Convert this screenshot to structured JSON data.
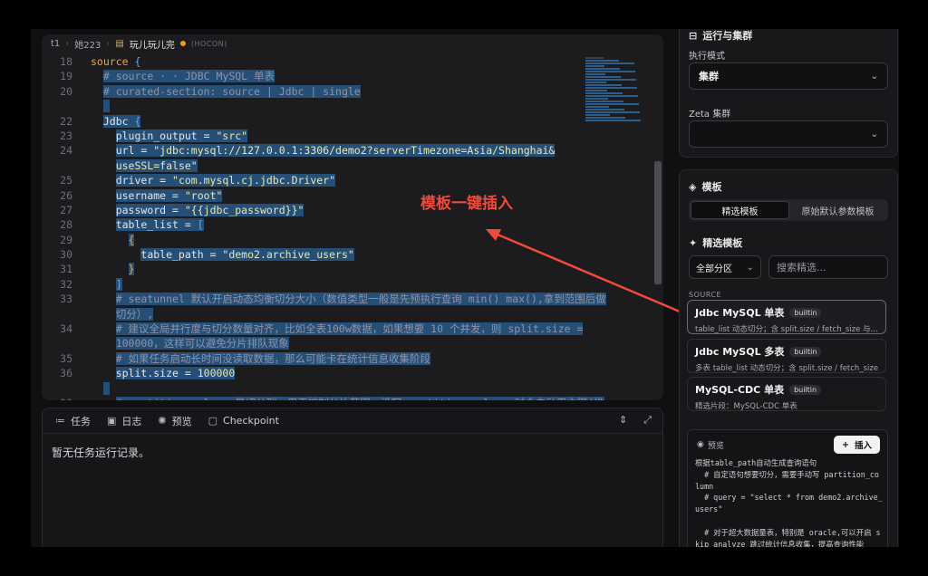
{
  "breadcrumb": {
    "items": [
      "t1",
      "她223",
      "玩儿玩儿完"
    ],
    "lang": "(HOCON)"
  },
  "editor": {
    "lines": [
      {
        "n": "18",
        "indent": "",
        "parts": [
          {
            "t": "source ",
            "c": "kw"
          },
          {
            "t": "{",
            "c": "br"
          }
        ],
        "sel": false
      },
      {
        "n": "19",
        "indent": "  ",
        "parts": [
          {
            "t": "# source · · JDBC MySQL 单表",
            "c": "cmt"
          }
        ],
        "sel": true
      },
      {
        "n": "20",
        "indent": "  ",
        "parts": [
          {
            "t": "# curated-section: source | Jdbc | single",
            "c": "cmt"
          }
        ],
        "sel": true
      },
      {
        "n": "",
        "indent": "  ",
        "parts": [
          {
            "t": " ",
            "c": ""
          }
        ],
        "sel": true
      },
      {
        "n": "22",
        "indent": "  ",
        "parts": [
          {
            "t": "Jdbc ",
            "c": ""
          },
          {
            "t": "{",
            "c": "br"
          }
        ],
        "sel": true
      },
      {
        "n": "23",
        "indent": "    ",
        "parts": [
          {
            "t": "plugin_output = ",
            "c": ""
          },
          {
            "t": "\"src\"",
            "c": "str"
          }
        ],
        "sel": true
      },
      {
        "n": "24",
        "indent": "    ",
        "parts": [
          {
            "t": "url = ",
            "c": ""
          },
          {
            "t": "\"jdbc:mysql://127.0.0.1:3306/demo2?serverTimezone=Asia/Shanghai&",
            "c": "str"
          }
        ],
        "sel": true
      },
      {
        "n": "",
        "indent": "    ",
        "parts": [
          {
            "t": "useSSL=false\"",
            "c": "str"
          }
        ],
        "sel": true
      },
      {
        "n": "25",
        "indent": "    ",
        "parts": [
          {
            "t": "driver = ",
            "c": ""
          },
          {
            "t": "\"com.mysql.cj.jdbc.Driver\"",
            "c": "str"
          }
        ],
        "sel": true
      },
      {
        "n": "26",
        "indent": "    ",
        "parts": [
          {
            "t": "username = ",
            "c": ""
          },
          {
            "t": "\"root\"",
            "c": "str"
          }
        ],
        "sel": true
      },
      {
        "n": "27",
        "indent": "    ",
        "parts": [
          {
            "t": "password = ",
            "c": ""
          },
          {
            "t": "\"{{jdbc_password}}\"",
            "c": "str"
          }
        ],
        "sel": true
      },
      {
        "n": "28",
        "indent": "    ",
        "parts": [
          {
            "t": "table_list = ",
            "c": ""
          },
          {
            "t": "[",
            "c": "br"
          }
        ],
        "sel": true
      },
      {
        "n": "29",
        "indent": "      ",
        "parts": [
          {
            "t": "{",
            "c": "kw"
          }
        ],
        "sel": true
      },
      {
        "n": "30",
        "indent": "        ",
        "parts": [
          {
            "t": "table_path = ",
            "c": ""
          },
          {
            "t": "\"demo2.archive_users\"",
            "c": "str"
          }
        ],
        "sel": true
      },
      {
        "n": "31",
        "indent": "      ",
        "parts": [
          {
            "t": "}",
            "c": "kw"
          }
        ],
        "sel": true
      },
      {
        "n": "32",
        "indent": "    ",
        "parts": [
          {
            "t": "]",
            "c": "br"
          }
        ],
        "sel": true
      },
      {
        "n": "33",
        "indent": "    ",
        "parts": [
          {
            "t": "# seatunnel 默认开启动态均衡切分大小（数值类型一般是先预执行查询 min() max(),拿到范围后做",
            "c": "cmt"
          }
        ],
        "sel": true
      },
      {
        "n": "",
        "indent": "    ",
        "parts": [
          {
            "t": "切分）,",
            "c": "cmt"
          }
        ],
        "sel": true
      },
      {
        "n": "34",
        "indent": "    ",
        "parts": [
          {
            "t": "# 建议全局并行度与切分数量对齐，比如全表100w数据，如果想要 10 个并发，则 split.size =",
            "c": "cmt"
          }
        ],
        "sel": true
      },
      {
        "n": "",
        "indent": "    ",
        "parts": [
          {
            "t": "100000，这样可以避免分片排队现象",
            "c": "cmt"
          }
        ],
        "sel": true
      },
      {
        "n": "35",
        "indent": "    ",
        "parts": [
          {
            "t": "# 如果任务启动长时间没读取数据，那么可能卡在统计信息收集阶段",
            "c": "cmt"
          }
        ],
        "sel": true
      },
      {
        "n": "36",
        "indent": "    ",
        "parts": [
          {
            "t": "split.size = ",
            "c": ""
          },
          {
            "t": "100000",
            "c": "str"
          }
        ],
        "sel": true
      },
      {
        "n": "",
        "indent": "  ",
        "parts": [
          {
            "t": " ",
            "c": ""
          }
        ],
        "sel": true
      },
      {
        "n": "38",
        "indent": "    ",
        "parts": [
          {
            "t": "# partition_column 是切分列，用于控制分片范围，没写 partition_column 时会自动用主键(推",
            "c": "cmt"
          }
        ],
        "sel": true
      }
    ]
  },
  "bottom": {
    "tabs": [
      {
        "icon": "≔",
        "label": "任务"
      },
      {
        "icon": "▣",
        "label": "日志"
      },
      {
        "icon": "✺",
        "label": "预览"
      },
      {
        "icon": "▢",
        "label": "Checkpoint"
      }
    ],
    "empty_text": "暂无任务运行记录。",
    "tools": [
      "⇕",
      "⤢"
    ]
  },
  "annotation": {
    "text": "模板一键插入",
    "color": "#f04a3a"
  },
  "run_panel": {
    "title": "运行与集群",
    "mode_label": "执行模式",
    "mode_value": "集群",
    "zeta_label": "Zeta 集群",
    "zeta_value": ""
  },
  "template_panel": {
    "title": "模板",
    "seg": [
      "精选模板",
      "原始默认参数模板"
    ],
    "section_title": "精选模板",
    "partition": "全部分区",
    "search_placeholder": "搜索精选...",
    "group": "SOURCE",
    "items": [
      {
        "name": "Jdbc MySQL 单表",
        "badge": "builtin",
        "desc": "table_list 动态切分；含 split.size / fetch_size 与..."
      },
      {
        "name": "Jdbc MySQL 多表",
        "badge": "builtin",
        "desc": "多表 table_list 动态切分；含 split.size / fetch_size ..."
      },
      {
        "name": "MySQL-CDC 单表",
        "badge": "builtin",
        "desc": "精选片段：MySQL-CDC 单表"
      }
    ],
    "preview_label": "预览",
    "insert_label": "插入",
    "preview_code": "根据table_path自动生成查询语句\n  # 自定语句想要切分，需要手动写 partition_co\nlumn\n  # query = \"select * from demo2.archive_\nusers\"\n\n  # 对于超大数据量表，特别是 oracle,可以开启 s\nkip_analyze 跳过统计信息收集，提高查询性能"
  },
  "colors": {
    "selection": "#264f78",
    "accent": "#f04a3a"
  }
}
